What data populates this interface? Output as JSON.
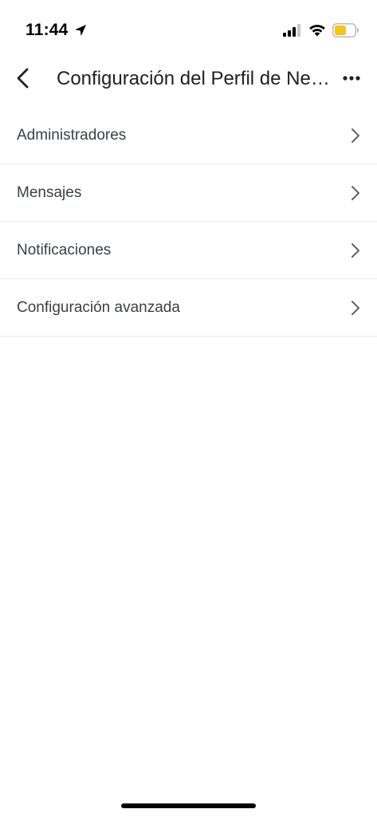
{
  "status_bar": {
    "time": "11:44",
    "location_icon": "location-arrow-icon",
    "signal_icon": "cellular-signal-icon",
    "wifi_icon": "wifi-icon",
    "battery_icon": "battery-icon",
    "battery_color": "#f5c518"
  },
  "app_bar": {
    "back_icon": "chevron-left-icon",
    "title": "Configuración del Perfil de Negocio",
    "more_icon": "more-horizontal-icon"
  },
  "settings": {
    "items": [
      {
        "label": "Administradores",
        "icon": "chevron-right-icon"
      },
      {
        "label": "Mensajes",
        "icon": "chevron-right-icon"
      },
      {
        "label": "Notificaciones",
        "icon": "chevron-right-icon"
      },
      {
        "label": "Configuración avanzada",
        "icon": "chevron-right-icon"
      }
    ]
  },
  "colors": {
    "background": "#ffffff",
    "text_primary": "#202124",
    "text_item": "#3c4043",
    "divider": "#ececec",
    "chevron": "#5f6368"
  }
}
